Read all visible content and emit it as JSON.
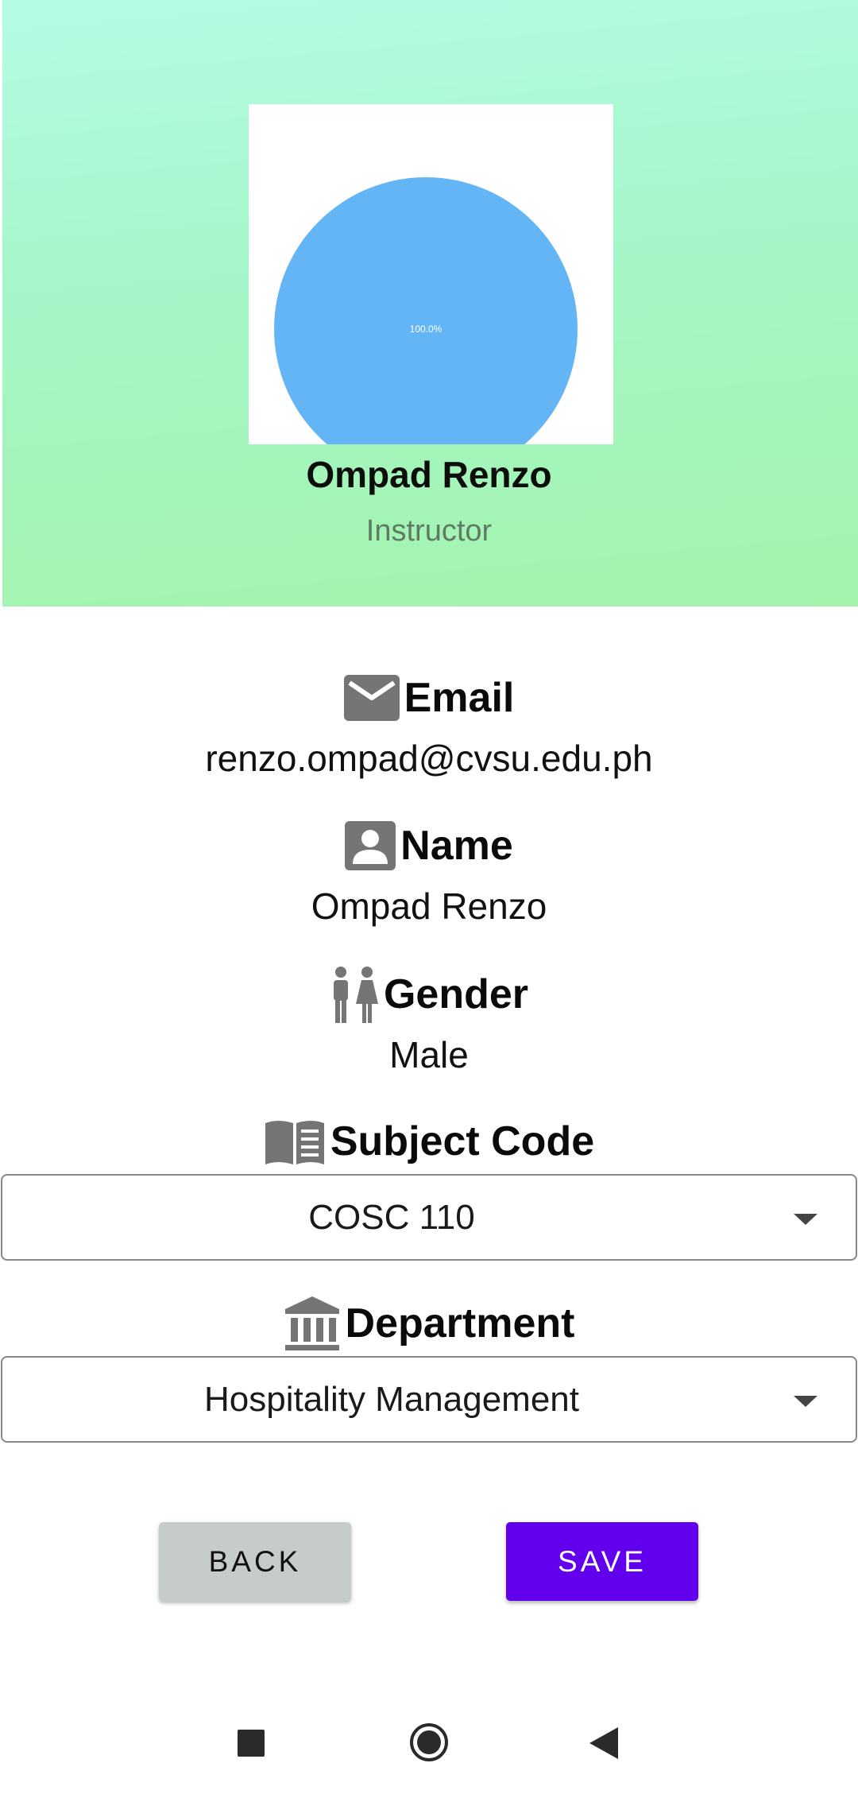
{
  "profile": {
    "name": "Ompad Renzo",
    "role": "Instructor",
    "photo_chart": {
      "type": "pie",
      "slice_label": "100.0%",
      "values": [
        100.0
      ],
      "colors": [
        "#64b5f6"
      ]
    }
  },
  "fields": {
    "email": {
      "label": "Email",
      "value": "renzo.ompad@cvsu.edu.ph",
      "icon": "mail-icon"
    },
    "name": {
      "label": "Name",
      "value": "Ompad Renzo",
      "icon": "person-icon"
    },
    "gender": {
      "label": "Gender",
      "value": "Male",
      "icon": "people-icon"
    },
    "subject_code": {
      "label": "Subject Code",
      "selected": "COSC 110",
      "icon": "book-icon"
    },
    "department": {
      "label": "Department",
      "selected": "Hospitality Management",
      "icon": "bank-icon"
    }
  },
  "buttons": {
    "back": "BACK",
    "save": "SAVE"
  },
  "colors": {
    "header_gradient_top": "#b4fce4",
    "header_gradient_bottom": "#a4f4ac",
    "save_button": "#6200ee",
    "back_button": "#c6cbcb",
    "pie": "#64b5f6",
    "icon_gray": "#757575"
  },
  "system_nav": {
    "icons": [
      "recent-apps-icon",
      "home-icon",
      "back-icon"
    ]
  }
}
